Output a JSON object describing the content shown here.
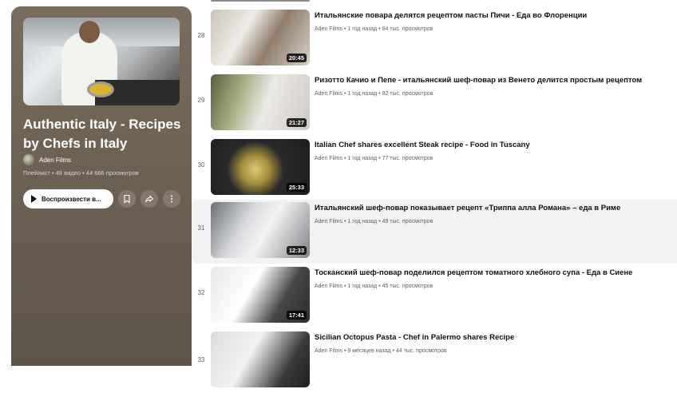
{
  "playlist": {
    "title": "Authentic Italy - Recipes by Chefs in Italy",
    "channel": "Aden Films",
    "meta": "Плейлист • 48 видео • 44 666 просмотров",
    "play_label": "Воспроизвести в...",
    "icons": [
      "save-playlist-icon",
      "share-icon",
      "more-icon"
    ]
  },
  "videos": [
    {
      "index": "28",
      "title": "Итальянские повара делятся рецептом пасты Пичи - Еда во Флоренции",
      "meta": "Aden Films • 1 год назад • 84 тыс. просмотров",
      "duration": "20:45"
    },
    {
      "index": "29",
      "title": "Ризотто Качио и Пепе - итальянский шеф-повар из Венето делится простым рецептом",
      "meta": "Aden Films • 1 год назад • 82 тыс. просмотров",
      "duration": "21:27"
    },
    {
      "index": "30",
      "title": "Italian Chef shares excellent Steak recipe - Food in Tuscany",
      "meta": "Aden Films • 1 год назад • 77 тыс. просмотров",
      "duration": "25:33"
    },
    {
      "index": "31",
      "title": "Итальянский шеф-повар показывает рецепт «Триппа алла Романа» – еда в Риме",
      "meta": "Aden Films • 1 год назад • 49 тыс. просмотров",
      "duration": "12:33"
    },
    {
      "index": "32",
      "title": "Тосканский шеф-повар поделился рецептом томатного хлебного супа - Еда в Сиене",
      "meta": "Aden Films • 1 год назад • 45 тыс. просмотров",
      "duration": "17:41"
    },
    {
      "index": "33",
      "title": "Sicilian Octopus Pasta - Chef in Palermo shares Recipe",
      "meta": "Aden Films • 9 месяцев назад • 44 тыс. просмотров",
      "duration": ""
    }
  ]
}
